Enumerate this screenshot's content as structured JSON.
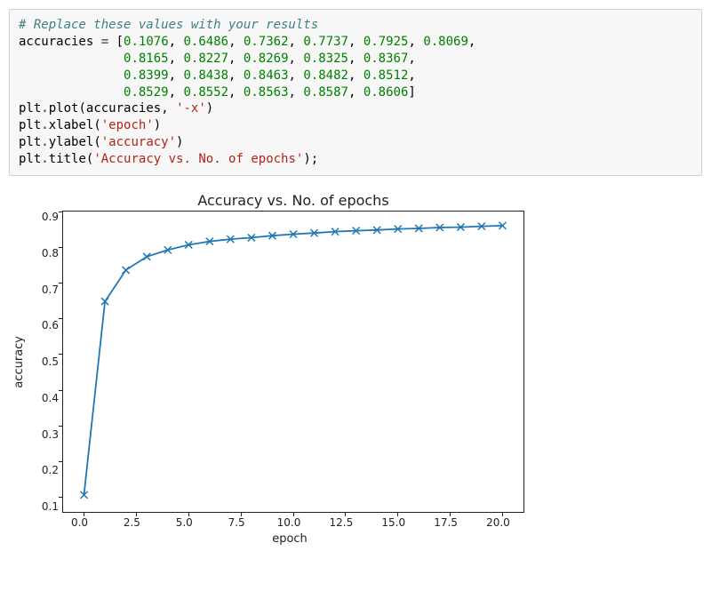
{
  "code": {
    "comment": "# Replace these values with your results",
    "var": "accuracies",
    "eq": "=",
    "lb": "[",
    "rb": "]",
    "comma": ",",
    "vals": [
      "0.1076",
      "0.6486",
      "0.7362",
      "0.7737",
      "0.7925",
      "0.8069",
      "0.8165",
      "0.8227",
      "0.8269",
      "0.8325",
      "0.8367",
      "0.8399",
      "0.8438",
      "0.8463",
      "0.8482",
      "0.8512",
      "0.8529",
      "0.8552",
      "0.8563",
      "0.8587",
      "0.8606"
    ],
    "l1a": "plt",
    "dot": ".",
    "plot": "plot",
    "lp": "(",
    "rp": ")",
    "arg_acc": "accuracies",
    "fmt": "'-x'",
    "xlabel_fn": "xlabel",
    "xlabel_arg": "'epoch'",
    "ylabel_fn": "ylabel",
    "ylabel_arg": "'accuracy'",
    "title_fn": "title",
    "title_arg": "'Accuracy vs. No. of epochs'",
    "semi": ";"
  },
  "chart_data": {
    "type": "line",
    "x": [
      0,
      1,
      2,
      3,
      4,
      5,
      6,
      7,
      8,
      9,
      10,
      11,
      12,
      13,
      14,
      15,
      16,
      17,
      18,
      19,
      20
    ],
    "values": [
      0.1076,
      0.6486,
      0.7362,
      0.7737,
      0.7925,
      0.8069,
      0.8165,
      0.8227,
      0.8269,
      0.8325,
      0.8367,
      0.8399,
      0.8438,
      0.8463,
      0.8482,
      0.8512,
      0.8529,
      0.8552,
      0.8563,
      0.8587,
      0.8606
    ],
    "title": "Accuracy vs. No. of epochs",
    "xlabel": "epoch",
    "ylabel": "accuracy",
    "xlim": [
      -1,
      21
    ],
    "ylim": [
      0.06,
      0.9
    ],
    "xticks": [
      "0.0",
      "2.5",
      "5.0",
      "7.5",
      "10.0",
      "12.5",
      "15.0",
      "17.5",
      "20.0"
    ],
    "yticks": [
      "0.9",
      "0.8",
      "0.7",
      "0.6",
      "0.5",
      "0.4",
      "0.3",
      "0.2",
      "0.1"
    ],
    "marker": "x",
    "color": "#1f77b4"
  }
}
